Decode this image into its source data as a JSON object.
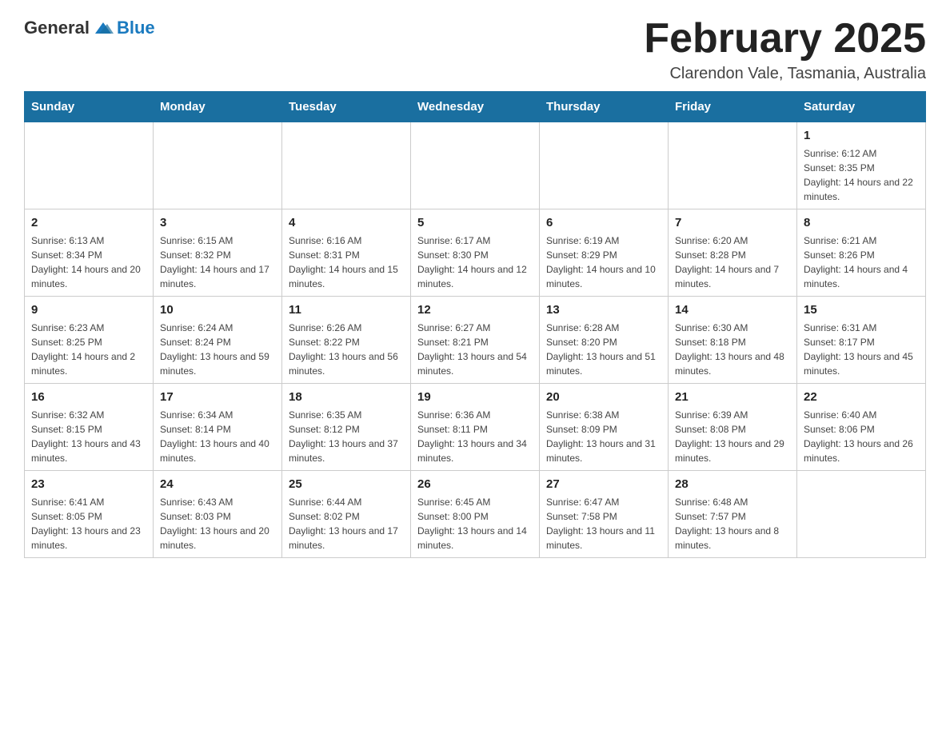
{
  "header": {
    "logo": {
      "general": "General",
      "blue": "Blue"
    },
    "title": "February 2025",
    "subtitle": "Clarendon Vale, Tasmania, Australia"
  },
  "calendar": {
    "weekdays": [
      "Sunday",
      "Monday",
      "Tuesday",
      "Wednesday",
      "Thursday",
      "Friday",
      "Saturday"
    ],
    "weeks": [
      [
        {
          "day": "",
          "info": ""
        },
        {
          "day": "",
          "info": ""
        },
        {
          "day": "",
          "info": ""
        },
        {
          "day": "",
          "info": ""
        },
        {
          "day": "",
          "info": ""
        },
        {
          "day": "",
          "info": ""
        },
        {
          "day": "1",
          "info": "Sunrise: 6:12 AM\nSunset: 8:35 PM\nDaylight: 14 hours and 22 minutes."
        }
      ],
      [
        {
          "day": "2",
          "info": "Sunrise: 6:13 AM\nSunset: 8:34 PM\nDaylight: 14 hours and 20 minutes."
        },
        {
          "day": "3",
          "info": "Sunrise: 6:15 AM\nSunset: 8:32 PM\nDaylight: 14 hours and 17 minutes."
        },
        {
          "day": "4",
          "info": "Sunrise: 6:16 AM\nSunset: 8:31 PM\nDaylight: 14 hours and 15 minutes."
        },
        {
          "day": "5",
          "info": "Sunrise: 6:17 AM\nSunset: 8:30 PM\nDaylight: 14 hours and 12 minutes."
        },
        {
          "day": "6",
          "info": "Sunrise: 6:19 AM\nSunset: 8:29 PM\nDaylight: 14 hours and 10 minutes."
        },
        {
          "day": "7",
          "info": "Sunrise: 6:20 AM\nSunset: 8:28 PM\nDaylight: 14 hours and 7 minutes."
        },
        {
          "day": "8",
          "info": "Sunrise: 6:21 AM\nSunset: 8:26 PM\nDaylight: 14 hours and 4 minutes."
        }
      ],
      [
        {
          "day": "9",
          "info": "Sunrise: 6:23 AM\nSunset: 8:25 PM\nDaylight: 14 hours and 2 minutes."
        },
        {
          "day": "10",
          "info": "Sunrise: 6:24 AM\nSunset: 8:24 PM\nDaylight: 13 hours and 59 minutes."
        },
        {
          "day": "11",
          "info": "Sunrise: 6:26 AM\nSunset: 8:22 PM\nDaylight: 13 hours and 56 minutes."
        },
        {
          "day": "12",
          "info": "Sunrise: 6:27 AM\nSunset: 8:21 PM\nDaylight: 13 hours and 54 minutes."
        },
        {
          "day": "13",
          "info": "Sunrise: 6:28 AM\nSunset: 8:20 PM\nDaylight: 13 hours and 51 minutes."
        },
        {
          "day": "14",
          "info": "Sunrise: 6:30 AM\nSunset: 8:18 PM\nDaylight: 13 hours and 48 minutes."
        },
        {
          "day": "15",
          "info": "Sunrise: 6:31 AM\nSunset: 8:17 PM\nDaylight: 13 hours and 45 minutes."
        }
      ],
      [
        {
          "day": "16",
          "info": "Sunrise: 6:32 AM\nSunset: 8:15 PM\nDaylight: 13 hours and 43 minutes."
        },
        {
          "day": "17",
          "info": "Sunrise: 6:34 AM\nSunset: 8:14 PM\nDaylight: 13 hours and 40 minutes."
        },
        {
          "day": "18",
          "info": "Sunrise: 6:35 AM\nSunset: 8:12 PM\nDaylight: 13 hours and 37 minutes."
        },
        {
          "day": "19",
          "info": "Sunrise: 6:36 AM\nSunset: 8:11 PM\nDaylight: 13 hours and 34 minutes."
        },
        {
          "day": "20",
          "info": "Sunrise: 6:38 AM\nSunset: 8:09 PM\nDaylight: 13 hours and 31 minutes."
        },
        {
          "day": "21",
          "info": "Sunrise: 6:39 AM\nSunset: 8:08 PM\nDaylight: 13 hours and 29 minutes."
        },
        {
          "day": "22",
          "info": "Sunrise: 6:40 AM\nSunset: 8:06 PM\nDaylight: 13 hours and 26 minutes."
        }
      ],
      [
        {
          "day": "23",
          "info": "Sunrise: 6:41 AM\nSunset: 8:05 PM\nDaylight: 13 hours and 23 minutes."
        },
        {
          "day": "24",
          "info": "Sunrise: 6:43 AM\nSunset: 8:03 PM\nDaylight: 13 hours and 20 minutes."
        },
        {
          "day": "25",
          "info": "Sunrise: 6:44 AM\nSunset: 8:02 PM\nDaylight: 13 hours and 17 minutes."
        },
        {
          "day": "26",
          "info": "Sunrise: 6:45 AM\nSunset: 8:00 PM\nDaylight: 13 hours and 14 minutes."
        },
        {
          "day": "27",
          "info": "Sunrise: 6:47 AM\nSunset: 7:58 PM\nDaylight: 13 hours and 11 minutes."
        },
        {
          "day": "28",
          "info": "Sunrise: 6:48 AM\nSunset: 7:57 PM\nDaylight: 13 hours and 8 minutes."
        },
        {
          "day": "",
          "info": ""
        }
      ]
    ]
  }
}
